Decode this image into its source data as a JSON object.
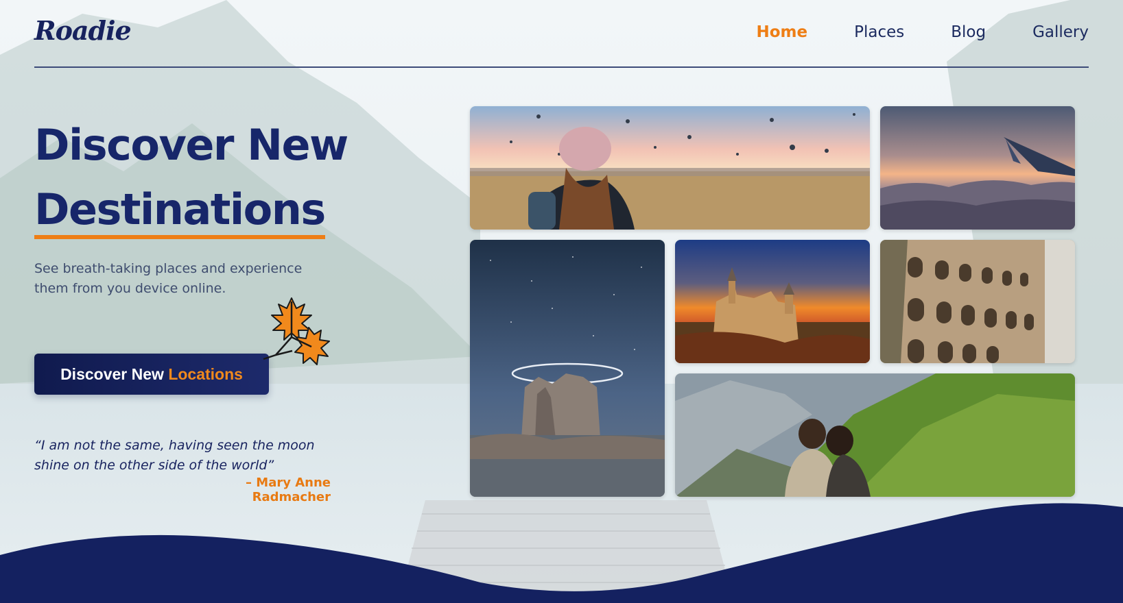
{
  "brand": {
    "logo_text": "Roadie"
  },
  "nav": {
    "items": [
      {
        "label": "Home",
        "active": true
      },
      {
        "label": "Places",
        "active": false
      },
      {
        "label": "Blog",
        "active": false
      },
      {
        "label": "Gallery",
        "active": false
      }
    ]
  },
  "hero": {
    "title_line1": "Discover New",
    "title_line2": "Destinations",
    "subtitle": "See breath-taking places and experience them from you device online.",
    "cta_main": "Discover New ",
    "cta_accent": "Locations"
  },
  "quote": {
    "text": "“I am not the same, having seen the moon shine on the other side of the world”",
    "author": "– Mary Anne Radmacher"
  },
  "gallery": {
    "photos": [
      {
        "subject": "hot-air-balloons-traveler"
      },
      {
        "subject": "airplane-wing-above-clouds"
      },
      {
        "subject": "rock-formation-night-sky"
      },
      {
        "subject": "castle-at-sunset"
      },
      {
        "subject": "colosseum"
      },
      {
        "subject": "couple-on-green-mountain"
      }
    ]
  },
  "colors": {
    "navy": "#17225e",
    "accent": "#ee7e15",
    "wave": "#142160"
  }
}
